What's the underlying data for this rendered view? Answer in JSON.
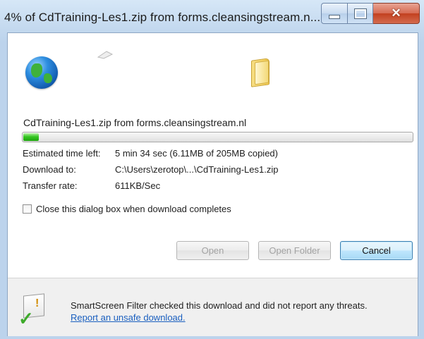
{
  "window": {
    "title": "4% of CdTraining-Les1.zip from forms.cleansingstream.n...",
    "buttons": {
      "minimize": "minimize",
      "maximize": "maximize",
      "close": "✕"
    }
  },
  "download": {
    "file_label": "CdTraining-Les1.zip from forms.cleansingstream.nl",
    "progress_fraction": 0.04,
    "progress_color": "#2dbd1c",
    "details": [
      {
        "key": "Estimated time left:",
        "value": "5 min 34 sec (6.11MB of 205MB copied)"
      },
      {
        "key": "Download to:",
        "value": "C:\\Users\\zerotop\\...\\CdTraining-Les1.zip"
      },
      {
        "key": "Transfer rate:",
        "value": "611KB/Sec"
      }
    ],
    "close_when_complete": {
      "label": "Close this dialog box when download completes",
      "checked": false
    }
  },
  "actions": {
    "open": "Open",
    "open_folder": "Open Folder",
    "cancel": "Cancel"
  },
  "smartscreen": {
    "text": "SmartScreen Filter checked this download and did not report any threats.",
    "link": "Report an unsafe download."
  },
  "icons": {
    "globe": "globe-icon",
    "paper": "flying-paper-icon",
    "folder": "folder-icon",
    "shield": "smartscreen-shield-icon"
  }
}
